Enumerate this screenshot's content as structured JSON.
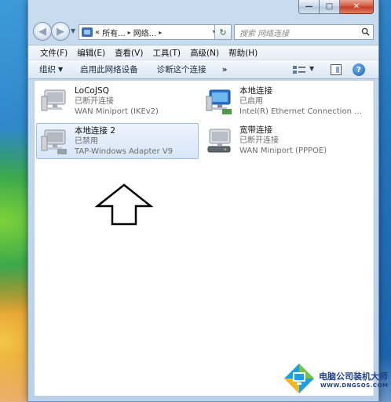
{
  "window": {
    "caption": {
      "minimize": "—",
      "maximize": "□",
      "close": "✕"
    }
  },
  "address": {
    "back": "◀",
    "forward": "▶",
    "breadcrumbs": [
      "«",
      "所有...",
      "网络...",
      ""
    ],
    "separator": "▸",
    "dropdown": "▼",
    "refresh": "↻"
  },
  "search": {
    "placeholder": "搜索 网络连接"
  },
  "menu": {
    "items": [
      "文件(F)",
      "编辑(E)",
      "查看(V)",
      "工具(T)",
      "高级(N)",
      "帮助(H)"
    ]
  },
  "commands": {
    "organize": "组织",
    "organize_drop": "▼",
    "enable": "启用此网络设备",
    "diagnose": "诊断这个连接",
    "more": "»",
    "view_drop": "▼",
    "help": "?"
  },
  "connections": [
    {
      "name": "LoCoJSQ",
      "status": "已断开连接",
      "device": "WAN Miniport (IKEv2)",
      "icon": "network-connection-icon",
      "selected": false
    },
    {
      "name": "本地连接",
      "status": "已启用",
      "device": "Intel(R) Ethernet Connection I2...",
      "icon": "network-connection-icon",
      "selected": false
    },
    {
      "name": "本地连接 2",
      "status": "已禁用",
      "device": "TAP-Windows Adapter V9",
      "icon": "network-connection-icon",
      "selected": true
    },
    {
      "name": "宽带连接",
      "status": "已断开连接",
      "device": "WAN Miniport (PPPOE)",
      "icon": "modem-connection-icon",
      "selected": false
    }
  ],
  "watermark": {
    "title": "电脑公司装机大师",
    "url": "WWW.DNGSOS.COM"
  },
  "colors": {
    "selection": "#d7e6f8",
    "selection_border": "#9bbfe6",
    "accent": "#1f3f86"
  }
}
